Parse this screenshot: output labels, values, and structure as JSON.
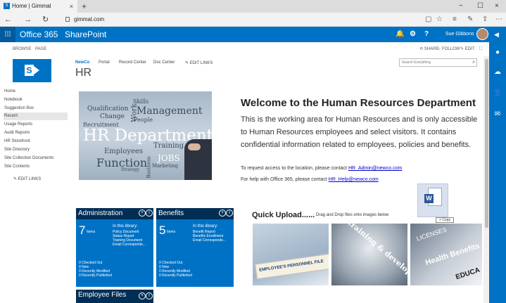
{
  "browser": {
    "tab_title": "Home | Gimmal",
    "tab_close": "×",
    "new_tab": "+",
    "url": "gimmal.com",
    "window_controls": [
      "−",
      "☐",
      "×"
    ]
  },
  "suite": {
    "app_name": "Office 365",
    "product": "SharePoint",
    "user_name": "Sue Gibbons",
    "help": "?"
  },
  "ribbon": {
    "browse": "BROWSE",
    "page": "PAGE",
    "share": "SHARE",
    "follow": "FOLLOW",
    "edit": "EDIT"
  },
  "header": {
    "nav": [
      "NewCo",
      "Portal",
      "Record Center",
      "Doc Center"
    ],
    "edit_links": "EDIT LINKS",
    "site_title": "HR",
    "search_placeholder": "Search Everything"
  },
  "quick_launch": {
    "items": [
      "Home",
      "Notebook",
      "Suggestion Box",
      "Recent",
      "Usage Reports",
      "Audit Reports",
      "HR Storefront",
      "Site Directory",
      "Site Collection Documents",
      "Site Contents"
    ],
    "edit_links": "EDIT LINKS"
  },
  "hero_words": {
    "w1": "Qualification",
    "w2": "Skills",
    "w3": "Change",
    "w4": "Management",
    "w5": "Work",
    "w6": "Recruitment",
    "w7": "People",
    "w8": "HR Department",
    "w9": "Employees",
    "w10": "Training",
    "w11": "Function",
    "w12": "JOBS",
    "w13": "Business",
    "w14": "Strategy",
    "w15": "Marketing"
  },
  "welcome": {
    "title": "Welcome to the Human Resources Department",
    "body": "This is the working area for Human Resources and is only accessible to Human Resources employees and select visitors. It contains confidential information related to employees, policies and benefits.",
    "access_text": "To request access to the location, please contact ",
    "access_email": "HR_Admin@newco.com",
    "help_text": "For help with Office 365, please contact ",
    "help_email": "HR_Help@newco.com"
  },
  "tiles": {
    "admin": {
      "title": "Administration",
      "count": "7",
      "items_label": "Items",
      "lib_label": "In this library:",
      "lib_items": [
        "Policy Document",
        "Status Report",
        "Training Document",
        "Email Correspondе..."
      ],
      "stats": [
        "0 Checked Out",
        "0 New",
        "0 Recently Modified",
        "0 Recently Published"
      ]
    },
    "benefits": {
      "title": "Benefits",
      "count": "5",
      "items_label": "Items",
      "lib_label": "In this library:",
      "lib_items": [
        "Benefit Report",
        "Benefits Enrollment",
        "Email Correspondе..."
      ],
      "stats": [
        "0 Checked Out",
        "0 New",
        "0 Recently Modified",
        "0 Recently Published"
      ]
    },
    "employee_files": {
      "title": "Employee Files"
    }
  },
  "quick_upload": {
    "title": "Quick Upload......",
    "subtitle": "Drag and Drop files onto images below",
    "img1_text": "EMPLOYEE'S PERSONNEL FILE",
    "img2_text": "training & development",
    "img3_text_a": "LICENSES",
    "img3_text_b": "Health Benefits",
    "img3_text_c": "EDUCA"
  },
  "drag": {
    "copy_label": "+ Copy",
    "word_letter": "W"
  },
  "colors": {
    "accent": "#0072c6",
    "tile_header": "#002e55"
  }
}
